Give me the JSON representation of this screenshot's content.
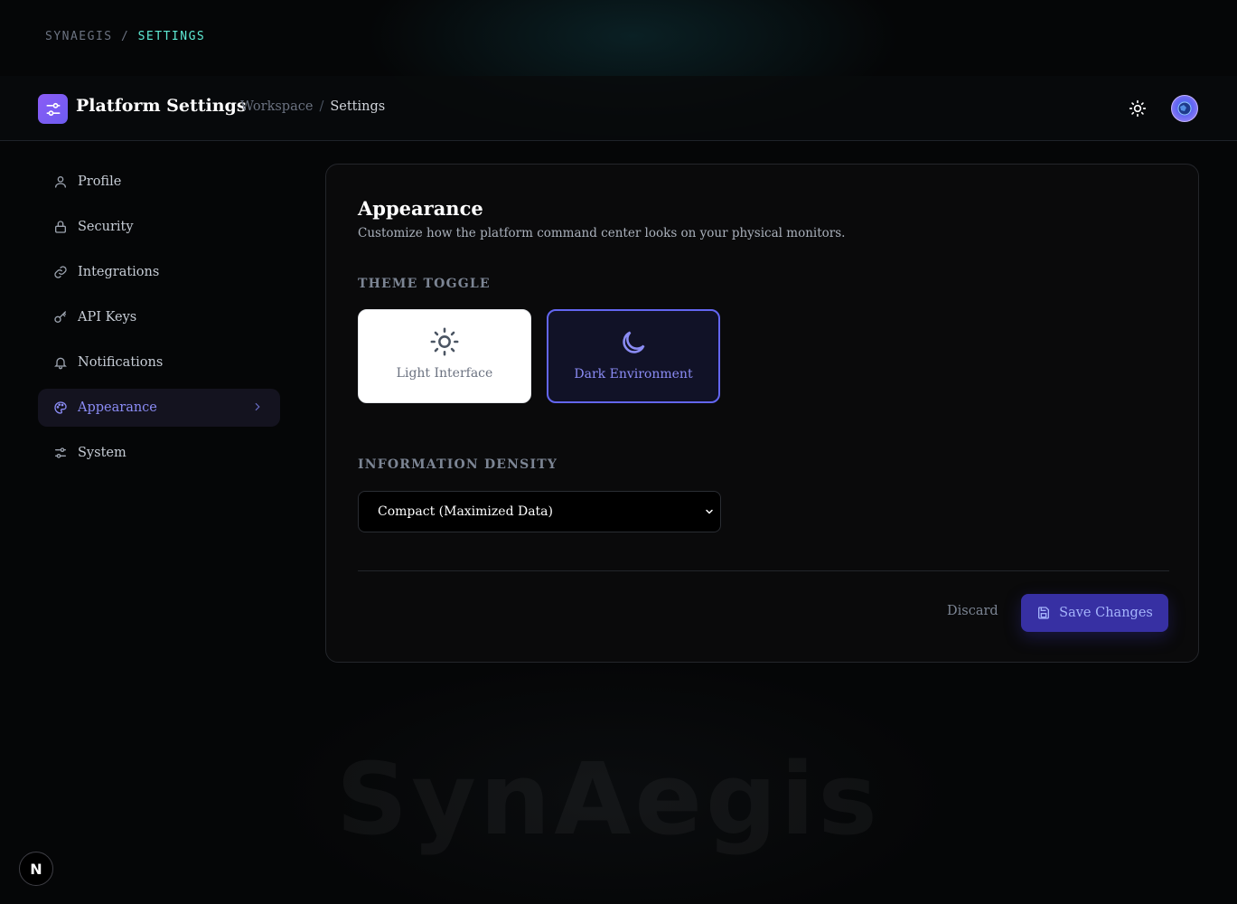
{
  "top_breadcrumb": {
    "root": "SYNAEGIS",
    "separator": " / ",
    "current": "SETTINGS"
  },
  "header": {
    "logo_icon": "sliders-icon",
    "title": "Platform Settings",
    "breadcrumb": {
      "parent": "Workspace",
      "separator": "/",
      "current": "Settings"
    },
    "theme_toggle_icon": "sun-icon",
    "avatar_icon": "globe-avatar"
  },
  "sidebar": {
    "items": [
      {
        "label": "Profile",
        "icon": "user-icon"
      },
      {
        "label": "Security",
        "icon": "lock-icon"
      },
      {
        "label": "Integrations",
        "icon": "link-icon"
      },
      {
        "label": "API Keys",
        "icon": "key-icon"
      },
      {
        "label": "Notifications",
        "icon": "bell-icon"
      },
      {
        "label": "Appearance",
        "icon": "palette-icon",
        "active": true
      },
      {
        "label": "System",
        "icon": "sliders-icon"
      }
    ]
  },
  "appearance": {
    "title": "Appearance",
    "description": "Customize how the platform command center looks on your physical monitors.",
    "theme_section_label": "THEME TOGGLE",
    "theme_options": [
      {
        "label": "Light Interface",
        "icon": "sun-icon",
        "selected": false
      },
      {
        "label": "Dark Environment",
        "icon": "moon-icon",
        "selected": true
      }
    ],
    "density_section_label": "INFORMATION DENSITY",
    "density_selected": "Compact (Maximized Data)",
    "discard_label": "Discard",
    "save_label": "Save Changes",
    "save_icon": "save-icon"
  },
  "watermark": "SynAegis",
  "badge": "N",
  "colors": {
    "accent": "#6366f1",
    "crumb_accent": "#5eead4",
    "save_button": "#3730a3",
    "logo": "#8b5cf6"
  }
}
